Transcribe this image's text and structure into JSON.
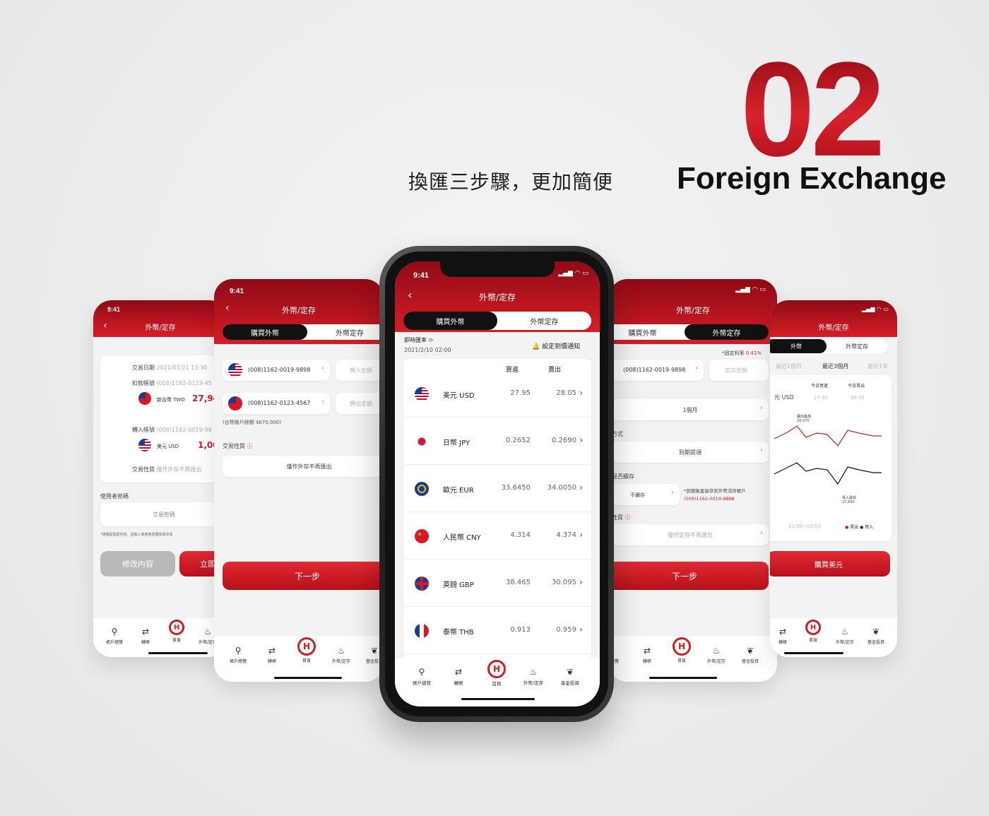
{
  "hero": {
    "number": "02",
    "title_en": "Foreign Exchange",
    "subtitle_zh": "換匯三步驟，更加簡便"
  },
  "common": {
    "status_time": "9:41",
    "page_title": "外幣/定存",
    "tab_buy": "購買外幣",
    "tab_deposit": "外幣定存",
    "next_button": "下一步",
    "nav": {
      "accounts": "帳戶總覽",
      "transfer": "轉帳",
      "home": "首頁",
      "fx": "外幣/定存",
      "fund": "基金投資"
    }
  },
  "screen_confirm": {
    "trade_date_label": "交易日期",
    "trade_date_value": "2021/01/21 13:30",
    "debit_label": "扣款帳號",
    "debit_value": "(008)1162-0123-45",
    "debit_currency": "新台幣 TWD",
    "debit_amount": "27,94",
    "credit_label": "轉入帳號",
    "credit_value": "(008)1162-0019-98",
    "credit_currency": "美元 USD",
    "credit_amount": "1,00",
    "nature_label": "交易性質",
    "nature_value": "僅作外存不再匯出",
    "password_label": "使用者密碼",
    "password_placeholder": "交易密碼",
    "note": "*請確認換匯內容，並輸入使用者密碼完成交易",
    "edit_button": "修改內容",
    "confirm_button": "立即"
  },
  "screen_buy": {
    "account_usd": "(008)1162-0019-9898",
    "in_amount": "轉入金額",
    "account_twd": "(008)1162-0123-4567",
    "out_amount": "轉出金額",
    "balance_note": "(台幣帳戶餘額 $670,000)",
    "nature_label": "交易性質",
    "nature_value": "僅作外存不再匯出"
  },
  "screen_rates": {
    "realtime_label": "即時匯率",
    "datetime": "2021/2/10 02:00",
    "alert_label": "設定到價通知",
    "col_buy": "買進",
    "col_sell": "賣出",
    "rows": [
      {
        "name": "美元 USD",
        "buy": "27.95",
        "sell": "28.05",
        "flag": "us"
      },
      {
        "name": "日幣 JPY",
        "buy": "0.2652",
        "sell": "0.2690",
        "flag": "jp"
      },
      {
        "name": "歐元 EUR",
        "buy": "33.6450",
        "sell": "34.0050",
        "flag": "eu"
      },
      {
        "name": "人民幣 CNY",
        "buy": "4.314",
        "sell": "4.374",
        "flag": "cn"
      },
      {
        "name": "英鎊 GBP",
        "buy": "38.465",
        "sell": "30.095",
        "flag": "gb"
      },
      {
        "name": "泰幣 THB",
        "buy": "0.913",
        "sell": "0.959",
        "flag": "th"
      }
    ]
  },
  "screen_deposit": {
    "fixed_rate_label": "*固定利率",
    "fixed_rate_value": "0.41%",
    "account": "(008)1162-0019-9898",
    "amount_placeholder": "定存金額",
    "term": "1個月",
    "method_label": "方式",
    "method_value": "到期提領",
    "renew_label": "是否續存",
    "renew_value": "不續存",
    "renew_note": "*到期後直接存到外幣活存帳戶",
    "renew_account": "(008)1162-0019-9898",
    "nature_label": "性質",
    "nature_value": "僅作定存不再匯出"
  },
  "screen_chart": {
    "tab_left": "外幣",
    "tab_right": "外幣定存",
    "range_1m": "最近1個月",
    "range_3m": "最近3個月",
    "range_1y": "最近1年",
    "currency": "元 USD",
    "today_buy_label": "今日買進",
    "today_sell_label": "今日賣出",
    "today_buy": "27.95",
    "today_sell": "28.05",
    "sell_high_label": "賣出最高",
    "sell_high_value": "28.075",
    "buy_low_label": "買入最低",
    "buy_low_value": "27.895",
    "period": "11/30~02/08",
    "legend_sell": "賣出",
    "legend_buy": "買入",
    "buy_button": "購買美元"
  }
}
